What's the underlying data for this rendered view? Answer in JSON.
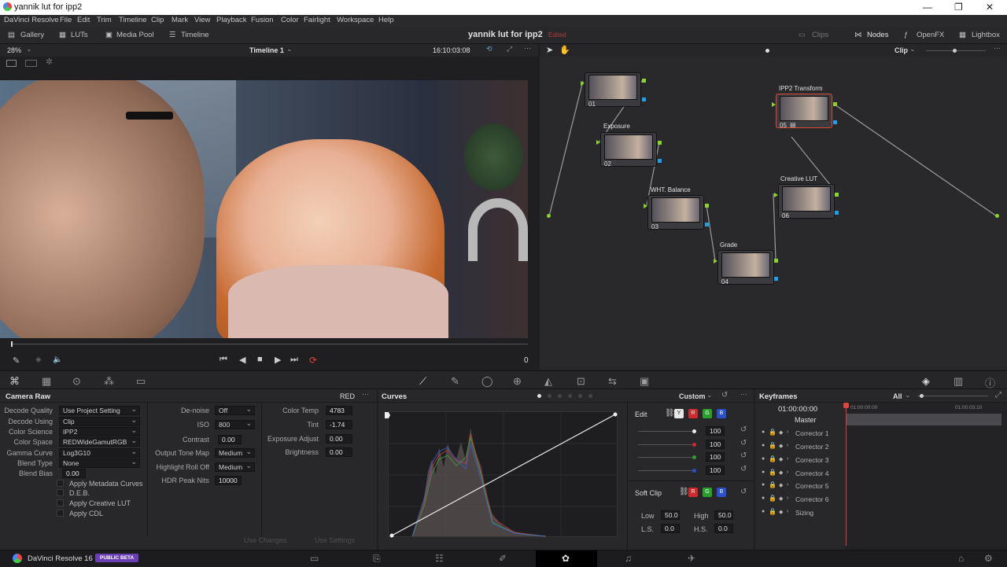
{
  "window": {
    "title": "yannik lut for ipp2",
    "minimize": "—",
    "maximize": "❐",
    "close": "✕"
  },
  "menu": [
    "DaVinci Resolve",
    "File",
    "Edit",
    "Trim",
    "Timeline",
    "Clip",
    "Mark",
    "View",
    "Playback",
    "Fusion",
    "Color",
    "Fairlight",
    "Workspace",
    "Help"
  ],
  "toolbar": {
    "gallery": "Gallery",
    "luts": "LUTs",
    "media_pool": "Media Pool",
    "timeline": "Timeline",
    "project": "yannik lut for ipp2",
    "edited": "Edited",
    "clips": "Clips",
    "nodes": "Nodes",
    "openfx": "OpenFX",
    "lightbox": "Lightbox"
  },
  "viewer": {
    "zoom": "28%",
    "timeline_name": "Timeline 1",
    "timecode": "16:10:03:08",
    "frame_counter": "0",
    "clip_mode": "Clip"
  },
  "nodes": [
    {
      "num": "01",
      "label": ""
    },
    {
      "num": "02",
      "label": "Exposure"
    },
    {
      "num": "03",
      "label": "WHT. Balance"
    },
    {
      "num": "04",
      "label": "Grade"
    },
    {
      "num": "05",
      "label": "IPP2 Transform"
    },
    {
      "num": "06",
      "label": "Creative LUT"
    }
  ],
  "camera_raw": {
    "title": "Camera Raw",
    "format": "RED",
    "decode_quality_label": "Decode Quality",
    "decode_quality": "Use Project Setting",
    "decode_using_label": "Decode Using",
    "decode_using": "Clip",
    "color_science_label": "Color Science",
    "color_science": "IPP2",
    "color_space_label": "Color Space",
    "color_space": "REDWideGamutRGB",
    "gamma_curve_label": "Gamma Curve",
    "gamma_curve": "Log3G10",
    "blend_type_label": "Blend Type",
    "blend_type": "None",
    "blend_bias_label": "Blend Bias",
    "blend_bias": "0.00",
    "apply_metadata_curves": "Apply Metadata Curves",
    "deb": "D.E.B.",
    "apply_creative_lut": "Apply Creative LUT",
    "apply_cdl": "Apply CDL",
    "denoise_label": "De-noise",
    "denoise": "Off",
    "iso_label": "ISO",
    "iso": "800",
    "contrast_label": "Contrast",
    "contrast": "0.00",
    "output_tone_map_label": "Output Tone Map",
    "output_tone_map": "Medium",
    "highlight_roll_off_label": "Highlight Roll Off",
    "highlight_roll_off": "Medium",
    "hdr_peak_nits_label": "HDR Peak Nits",
    "hdr_peak_nits": "10000",
    "color_temp_label": "Color Temp",
    "color_temp": "4783",
    "tint_label": "Tint",
    "tint": "-1.74",
    "exposure_adjust_label": "Exposure Adjust",
    "exposure_adjust": "0.00",
    "brightness_label": "Brightness",
    "brightness": "0.00",
    "use_changes": "Use Changes",
    "use_settings": "Use Settings"
  },
  "curves": {
    "title": "Curves",
    "mode": "Custom",
    "edit_label": "Edit",
    "y": "Y",
    "r": "R",
    "g": "G",
    "b": "B",
    "values": [
      "100",
      "100",
      "100",
      "100"
    ],
    "soft_clip_label": "Soft Clip",
    "low_label": "Low",
    "low": "50.0",
    "high_label": "High",
    "high": "50.0",
    "ls_label": "L.S.",
    "ls": "0.0",
    "hs_label": "H.S.",
    "hs": "0.0"
  },
  "keyframes": {
    "title": "Keyframes",
    "filter": "All",
    "timecode": "01:00:00:00",
    "ruler_start": "01:00:00:00",
    "ruler_end": "01:00:03:10",
    "master": "Master",
    "rows": [
      "Corrector 1",
      "Corrector 2",
      "Corrector 3",
      "Corrector 4",
      "Corrector 5",
      "Corrector 6",
      "Sizing"
    ]
  },
  "bottom": {
    "app": "DaVinci Resolve 16",
    "badge": "PUBLIC BETA"
  },
  "colors": {
    "accent_red": "#e0433a",
    "node_green": "#8bd42a",
    "node_blue": "#1ea0e8",
    "selected_node_border": "#d84a3a"
  }
}
